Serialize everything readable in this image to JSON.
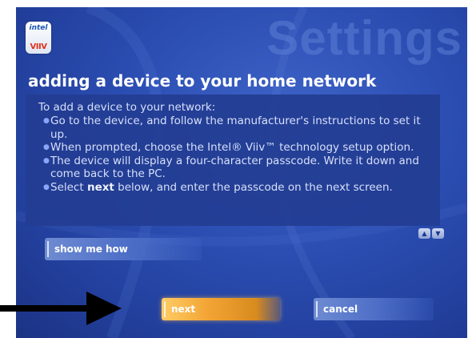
{
  "logo": {
    "line1": "intel",
    "line2": "VIIV"
  },
  "watermark": "Settings",
  "title": "adding a device to your home network",
  "content": {
    "intro": "To add a device to your network:",
    "bullets": [
      "Go to the device, and follow the manufacturer's instructions to set it up.",
      "When prompted, choose the Intel® Viiv™ technology setup option.",
      "The device will display a four-character passcode. Write it down and come back to the PC."
    ],
    "bullet4": {
      "pre": "Select ",
      "bold": "next",
      "post": " below, and enter the passcode on the next screen."
    }
  },
  "scroll": {
    "up": "▲",
    "down": "▼"
  },
  "buttons": {
    "show_me_how": "show me how",
    "next": "next",
    "cancel": "cancel"
  },
  "colors": {
    "background": "#2c4fb4",
    "accent": "#f2a433"
  }
}
